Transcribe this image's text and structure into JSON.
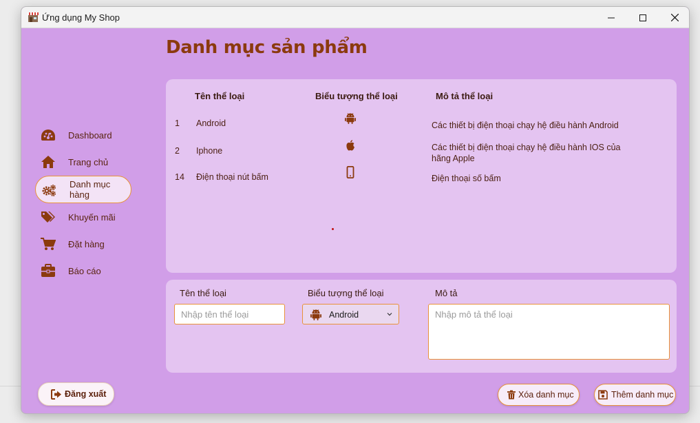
{
  "window": {
    "title": "Ứng dụng My Shop",
    "icon": "shop-icon"
  },
  "page": {
    "title": "Danh mục sản phẩm"
  },
  "sidebar": {
    "items": [
      {
        "label": "Dashboard",
        "icon": "dashboard-icon",
        "active": false
      },
      {
        "label": "Trang chủ",
        "icon": "home-icon",
        "active": false
      },
      {
        "label": "Danh mục hàng",
        "icon": "gears-icon",
        "active": true
      },
      {
        "label": "Khuyến mãi",
        "icon": "tags-icon",
        "active": false
      },
      {
        "label": "Đặt hàng",
        "icon": "cart-icon",
        "active": false
      },
      {
        "label": "Báo cáo",
        "icon": "briefcase-icon",
        "active": false
      }
    ],
    "logout_label": "Đăng xuất"
  },
  "table": {
    "headers": [
      "Tên thể loại",
      "Biểu tượng thể loại",
      "Mô tả thể loại"
    ],
    "rows": [
      {
        "id": "1",
        "name": "Android",
        "icon": "android-icon",
        "description": "Các thiết bị điện thoại chạy hệ điều hành Android"
      },
      {
        "id": "2",
        "name": "Iphone",
        "icon": "apple-icon",
        "description": "Các thiết bị điện thoại chạy hệ điều hành IOS của hãng Apple"
      },
      {
        "id": "14",
        "name": "Điện thoại nút bấm",
        "icon": "mobile-phone-icon",
        "description": "Điện thoại số bấm"
      }
    ]
  },
  "form": {
    "name_label": "Tên thể loại",
    "name_placeholder": "Nhập tên thể loại",
    "name_value": "",
    "icon_label": "Biểu tượng thể loại",
    "icon_selected": "Android",
    "desc_label": "Mô tả",
    "desc_placeholder": "Nhập mô tả thể loại",
    "desc_value": ""
  },
  "actions": {
    "delete_label": "Xóa danh mục",
    "add_label": "Thêm danh mục"
  },
  "colors": {
    "background": "#d19ee8",
    "panel": "#e4c4f1",
    "accent": "#e8923a",
    "title": "#8b3a0e",
    "icon": "#8b3a0e"
  }
}
